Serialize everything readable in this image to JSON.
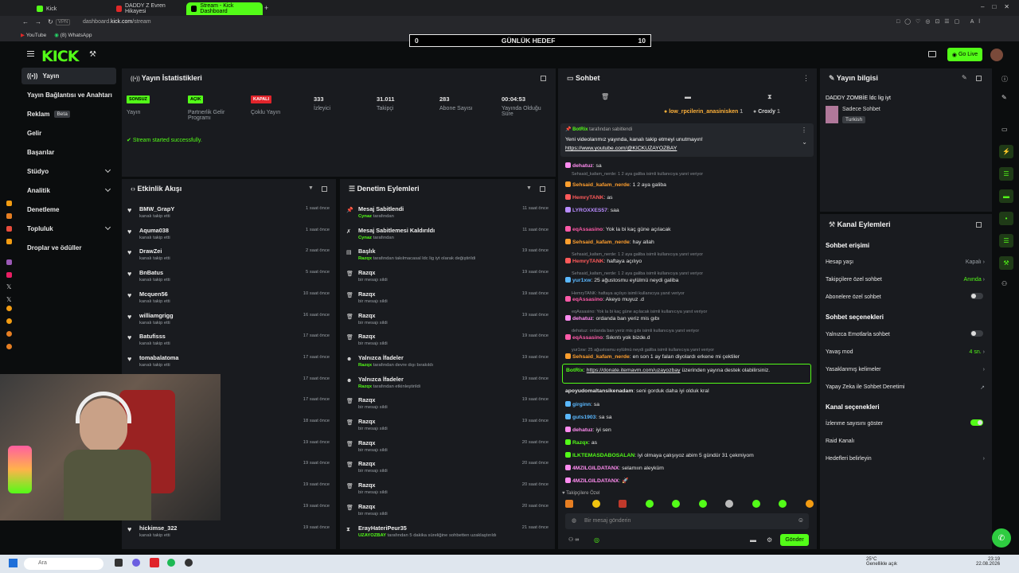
{
  "browser": {
    "tabs": [
      {
        "label": "Kick",
        "active": false
      },
      {
        "label": "DADDY Z Evren Hikayesi",
        "active": false
      },
      {
        "label": "Stream - Kick Dashboard",
        "active": true
      }
    ],
    "url_prefix": "dashboard.",
    "url_domain": "kick.com",
    "url_path": "/stream",
    "bookmarks": [
      "YouTube",
      "(8) WhatsApp"
    ]
  },
  "header": {
    "logo": "KICK",
    "goal": {
      "left": "0",
      "label": "GÜNLÜK HEDEF",
      "right": "10"
    },
    "go_live": "Go Live"
  },
  "sidebar": {
    "items": [
      {
        "label": "Yayın",
        "active": true
      },
      {
        "label": "Yayın Bağlantısı ve Anahtarı"
      },
      {
        "label": "Reklam",
        "badge": "Beta"
      },
      {
        "label": "Gelir"
      },
      {
        "label": "Başarılar"
      },
      {
        "label": "Stüdyo",
        "expand": true
      },
      {
        "label": "Analitik",
        "expand": true
      },
      {
        "label": "Denetleme"
      },
      {
        "label": "Topluluk",
        "expand": true
      },
      {
        "label": "Droplar ve ödüller"
      }
    ]
  },
  "stats_panel": {
    "title": "Yayın İstatistikleri",
    "stats": [
      {
        "badge": "SONSUZ",
        "badge_color": "#53fc18",
        "label": "Yayın"
      },
      {
        "badge": "AÇIK",
        "badge_color": "#53fc18",
        "label": "Partnerlik Gelir Programı"
      },
      {
        "badge": "KAPALI",
        "badge_color": "#e0242b",
        "label": "Çoklu Yayın"
      },
      {
        "value": "333",
        "label": "İzleyici"
      },
      {
        "value": "31.011",
        "label": "Takipçi"
      },
      {
        "value": "283",
        "label": "Abone Sayısı"
      },
      {
        "value": "00:04:53",
        "label": "Yayında Olduğu Süre"
      }
    ],
    "success_message": "Stream started successfully."
  },
  "activity_feed": {
    "title": "Etkinlik Akışı",
    "items": [
      {
        "name": "BMW_GrapY",
        "sub": "kanalı takip etti",
        "time": "1 saat önce"
      },
      {
        "name": "Aquma038",
        "sub": "kanalı takip etti",
        "time": "1 saat önce"
      },
      {
        "name": "DrawZei",
        "sub": "kanalı takip etti",
        "time": "2 saat önce"
      },
      {
        "name": "BnBatus",
        "sub": "kanalı takip etti",
        "time": "5 saat önce"
      },
      {
        "name": "Mcquen56",
        "sub": "kanalı takip etti",
        "time": "10 saat önce"
      },
      {
        "name": "williamgrigg",
        "sub": "kanalı takip etti",
        "time": "16 saat önce"
      },
      {
        "name": "Batufisss",
        "sub": "kanalı takip etti",
        "time": "17 saat önce"
      },
      {
        "name": "tomabalatoma",
        "sub": "kanalı takip etti",
        "time": "17 saat önce"
      },
      {
        "name": "",
        "sub": "",
        "time": "17 saat önce"
      },
      {
        "name": "",
        "sub": "",
        "time": "17 saat önce"
      },
      {
        "name": "",
        "sub": "",
        "time": "18 saat önce"
      },
      {
        "name": "",
        "sub": "",
        "time": "19 saat önce"
      },
      {
        "name": "",
        "sub": "",
        "time": "19 saat önce"
      },
      {
        "name": "",
        "sub": "",
        "time": "19 saat önce"
      },
      {
        "name": "",
        "sub": "",
        "time": "19 saat önce"
      },
      {
        "name": "hickimse_322",
        "sub": "kanalı takip etti",
        "time": "19 saat önce"
      }
    ]
  },
  "mod_actions": {
    "title": "Denetim Eylemleri",
    "items": [
      {
        "icon": "pin",
        "name": "Mesaj Sabitlendi",
        "user": "Cynaz",
        "sub": "tarafından",
        "time": "11 saat önce"
      },
      {
        "icon": "unpin",
        "name": "Mesaj Sabitlemesi Kaldırıldı",
        "user": "Cynaz",
        "sub": "tarafından",
        "time": "11 saat önce"
      },
      {
        "icon": "title",
        "name": "Başlık",
        "user": "Razqx",
        "sub": "tarafından takılmacasal ldc lig iyt olarak değiştirildi",
        "time": "19 saat önce"
      },
      {
        "icon": "trash",
        "name": "Razqx",
        "user": "",
        "sub": "bir mesajı sildi",
        "time": "19 saat önce"
      },
      {
        "icon": "trash",
        "name": "Razqx",
        "user": "",
        "sub": "bir mesajı sildi",
        "time": "19 saat önce"
      },
      {
        "icon": "trash",
        "name": "Razqx",
        "user": "",
        "sub": "bir mesajı sildi",
        "time": "19 saat önce"
      },
      {
        "icon": "trash",
        "name": "Razqx",
        "user": "",
        "sub": "bir mesajı sildi",
        "time": "19 saat önce"
      },
      {
        "icon": "emote",
        "name": "Yalnızca İfadeler",
        "user": "Razqx",
        "sub": "tarafından devre dışı bırakıldı",
        "time": "19 saat önce"
      },
      {
        "icon": "emote",
        "name": "Yalnızca İfadeler",
        "user": "Razqx",
        "sub": "tarafından etkinleştirildi",
        "time": "19 saat önce"
      },
      {
        "icon": "trash",
        "name": "Razqx",
        "user": "",
        "sub": "bir mesajı sildi",
        "time": "19 saat önce"
      },
      {
        "icon": "trash",
        "name": "Razqx",
        "user": "",
        "sub": "bir mesajı sildi",
        "time": "19 saat önce"
      },
      {
        "icon": "trash",
        "name": "Razqx",
        "user": "",
        "sub": "bir mesajı sildi",
        "time": "20 saat önce"
      },
      {
        "icon": "trash",
        "name": "Razqx",
        "user": "",
        "sub": "bir mesajı sildi",
        "time": "20 saat önce"
      },
      {
        "icon": "trash",
        "name": "Razqx",
        "user": "",
        "sub": "bir mesajı sildi",
        "time": "20 saat önce"
      },
      {
        "icon": "trash",
        "name": "Razqx",
        "user": "",
        "sub": "bir mesajı sildi",
        "time": "20 saat önce"
      },
      {
        "icon": "timeout",
        "name": "ErayHateriPeur35",
        "user": "UZAYOZBAY",
        "sub": "tarafından 5 dakika süreliğine sohbetten uzaklaştırıldı",
        "time": "21 saat önce"
      }
    ]
  },
  "chat": {
    "title": "Sohbet",
    "top_users": [
      {
        "name": "low_rpcilerin_anasinisken",
        "count": "1"
      },
      {
        "name": "Croxly",
        "count": "1"
      }
    ],
    "pinned": {
      "user": "BotRix",
      "sub": "tarafından sabitlendi",
      "text": "Yeni videolarımız yayında, kanalı takip etmeyi unutmayın!",
      "link": "https://www.youtube.com/@KICKUZAYOZBAY"
    },
    "messages": [
      {
        "reply": "",
        "user": "dehatuz",
        "color": "#ff8cf0",
        "text": "sa"
      },
      {
        "reply": "",
        "user": "Sehsaid_kafam_nerde",
        "color": "#ff9f2e",
        "text": "1 2 aya galiba"
      },
      {
        "reply": "",
        "user": "HemryTANK",
        "color": "#ff5a5a",
        "text": "as"
      },
      {
        "reply": "",
        "user": "LYROXXES57",
        "color": "#b98cff",
        "text": "saa"
      },
      {
        "reply": "Sehsaid_kafam_nerde: 1 2 aya galiba isimli kullanıcıya yanıt veriyor",
        "user": "eqAssasino",
        "color": "#ff5aa8",
        "text": "Yok la bi kaç güne açılacak"
      },
      {
        "reply": "",
        "user": "Sehsaid_kafam_nerde",
        "color": "#ff9f2e",
        "text": "hay allah"
      },
      {
        "reply": "Sehsaid_kafam_nerde: 1 2 aya galiba isimli kullanıcıya yanıt veriyor",
        "user": "HemryTANK",
        "color": "#ff5a5a",
        "text": "haftaya açılıyo"
      },
      {
        "reply": "Sehsaid_kafam_nerde: 1 2 aya galiba isimli kullanıcıya yanıt veriyor",
        "user": "yur1xw",
        "color": "#5ab8ff",
        "text": "25 ağustosmu eylülmü neydi galiba"
      },
      {
        "reply": "HemryTANK: haftaya açılıyo isimli kullanıcıya yanıt veriyor",
        "user": "eqAssasino",
        "color": "#ff5aa8",
        "text": "Akeyo muyuz .d"
      },
      {
        "reply": "eqAssasino: Yok la bi kaç güne açılacak isimli kullanıcıya yanıt veriyor",
        "user": "dehatuz",
        "color": "#ff8cf0",
        "text": "ordanda ban yeriz mis gıbı"
      },
      {
        "reply": "dehatuz: ordanda ban yeriz mis gıbı isimli kullanıcıya yanıt veriyor",
        "user": "eqAssasino",
        "color": "#ff5aa8",
        "text": "Sıkıntı yok bizde.d"
      },
      {
        "reply": "yur1xw: 25 ağustosmu eylülmü neydi galiba isimli kullanıcıya yanıt veriyor",
        "user": "Sehsaid_kafam_nerde",
        "color": "#ff9f2e",
        "text": "en son 1 ay falan diyolardı erkene mi çektiler"
      }
    ],
    "botrix": {
      "user": "BotRix",
      "link": "https://donate.itemavm.com/uzayozbay",
      "text": "üzerinden yayına destek olabilirsiniz."
    },
    "messages2": [
      {
        "user": "apoyudomaltansikenadam",
        "color": "#e8e8e8",
        "text": "seni gorduk daha iyi olduk kral"
      },
      {
        "user": "girginn",
        "color": "#5ab8ff",
        "text": "sa"
      },
      {
        "user": "guts1903",
        "color": "#5ab8ff",
        "text": "sa sa"
      },
      {
        "user": "dehatuz",
        "color": "#ff8cf0",
        "text": "iyi sen"
      },
      {
        "user": "Razqx",
        "color": "#53fc18",
        "text": "as"
      },
      {
        "user": "ILKTEMASDABOSALAN",
        "color": "#53fc18",
        "text": "iyi olmaya çalışıyoz abim 5 gündür 31 çekmiyom"
      },
      {
        "user": "4MZILGILDATANX",
        "color": "#ff8cf0",
        "text": "selamıın aleyküm"
      },
      {
        "user": "4MZILGILDATANX",
        "color": "#ff8cf0",
        "text": "🚀"
      }
    ],
    "followers_only": "Takipçilere Özel",
    "input_placeholder": "Bir mesaj gönderin",
    "send_label": "Gönder"
  },
  "stream_info": {
    "title": "Yayın bilgisi",
    "stream_title": "DADDY ZOMBİE ldc lig iyt",
    "category": "Sadece Sohbet",
    "tag": "Turkish"
  },
  "channel_actions": {
    "title": "Kanal Eylemleri",
    "chat_access": "Sohbet erişimi",
    "rows1": [
      {
        "label": "Hesap yaşı",
        "value": "Kapalı",
        "kind": "chev"
      },
      {
        "label": "Takipçilere özel sohbet",
        "value": "Anında",
        "kind": "chev",
        "green": true
      },
      {
        "label": "Abonelere özel sohbet",
        "kind": "toggle"
      }
    ],
    "chat_options": "Sohbet seçenekleri",
    "rows2": [
      {
        "label": "Yalnızca Emotlarla sohbet",
        "kind": "toggle"
      },
      {
        "label": "Yavaş mod",
        "value": "4 sn.",
        "kind": "chev",
        "green": true
      },
      {
        "label": "Yasaklanmış kelimeler",
        "kind": "chev"
      },
      {
        "label": "Yapay Zeka ile Sohbet Denetimi",
        "kind": "ext"
      }
    ],
    "channel_options": "Kanal seçenekleri",
    "rows3": [
      {
        "label": "İzlenme sayısını göster",
        "kind": "toggle-on"
      },
      {
        "label": "Raid Kanalı",
        "kind": "none"
      },
      {
        "label": "Hedefleri belirleyin",
        "kind": "chev"
      }
    ]
  },
  "taskbar": {
    "search_placeholder": "Ara",
    "weather": "25°C",
    "weather_sub": "Genellikle açık",
    "time": "23:19",
    "date": "22.08.2026"
  },
  "colors": {
    "accent": "#53fc18",
    "panel": "#191b1f",
    "bg": "#0b0d0e",
    "danger": "#e0242b"
  }
}
